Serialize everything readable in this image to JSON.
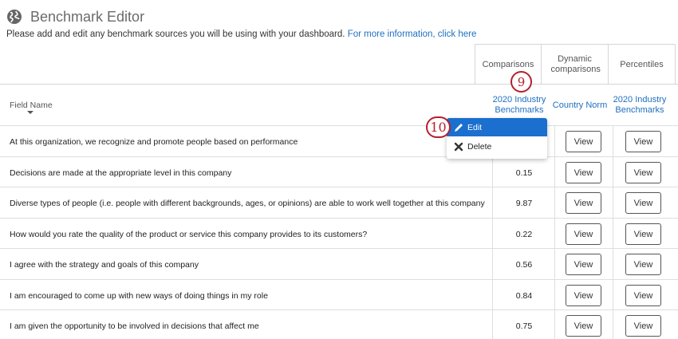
{
  "page": {
    "title": "Benchmark Editor",
    "subtitle": "Please add and edit any benchmark sources you will be using with your dashboard.",
    "info_link": "For more information, click here"
  },
  "tabs": [
    "Comparisons",
    "Dynamic comparisons",
    "Percentiles"
  ],
  "columns": {
    "field_name": "Field Name",
    "comparison": "2020 Industry Benchmarks",
    "dynamic": "Country Norm",
    "percentiles": "2020 Industry Benchmarks"
  },
  "rows": [
    {
      "text": "At this organization, we recognize and promote people based on performance",
      "value": ""
    },
    {
      "text": "Decisions are made at the appropriate level in this company",
      "value": "0.15"
    },
    {
      "text": "Diverse types of people (i.e. people with different backgrounds, ages, or opinions) are able to work well together at this company",
      "value": "9.87"
    },
    {
      "text": "How would you rate the quality of the product or service this company provides to its customers?",
      "value": "0.22"
    },
    {
      "text": "I agree with the strategy and goals of this company",
      "value": "0.56"
    },
    {
      "text": "I am encouraged to come up with new ways of doing things in my role",
      "value": "0.84"
    },
    {
      "text": "I am given the opportunity to be involved in decisions that affect me",
      "value": "0.75"
    }
  ],
  "view_label": "View",
  "context_menu": {
    "edit": "Edit",
    "delete": "Delete"
  },
  "callouts": {
    "step_9": "9",
    "step_10": "10"
  },
  "colors": {
    "link": "#1f6fbf",
    "menu_highlight": "#1a6fcf",
    "callout": "#b5202b"
  },
  "icons": [
    "globe-icon",
    "pencil-icon",
    "x-icon",
    "sort-caret-icon"
  ]
}
